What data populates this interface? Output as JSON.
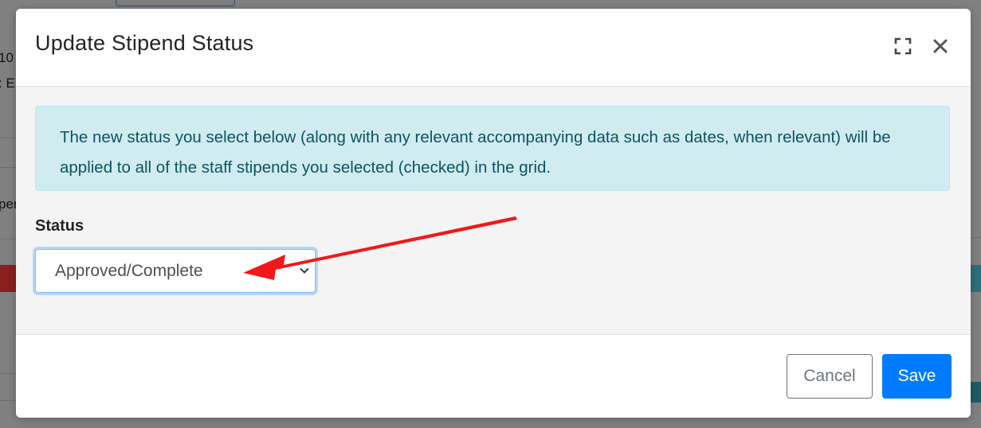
{
  "background": {
    "text_1": "10",
    "text_2": ": E",
    "text_3": "per"
  },
  "modal": {
    "title": "Update Stipend Status",
    "expand_icon": "expand-icon",
    "close_icon": "close-icon",
    "alert_text": "The new status you select below (along with any relevant accompanying data such as dates, when relevant) will be applied to all of the staff stipends you selected (checked) in the grid.",
    "status_label": "Status",
    "status_value": "Approved/Complete",
    "cancel_label": "Cancel",
    "save_label": "Save"
  },
  "annotation": {
    "arrow_color": "#f01818"
  },
  "colors": {
    "primary": "#007bff",
    "alert_bg": "#d1ecf1",
    "alert_text": "#0c5460"
  }
}
